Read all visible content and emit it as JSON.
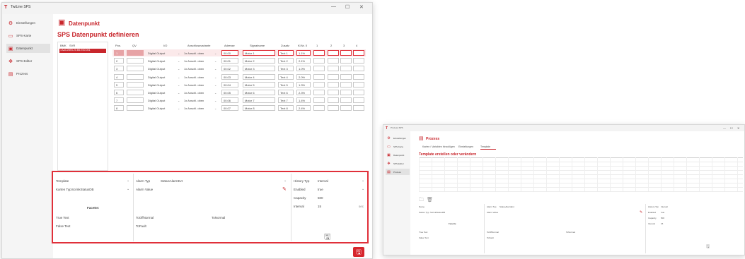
{
  "app": {
    "title": "TwiLine SPS"
  },
  "window_controls": [
    "—",
    "☐",
    "✕"
  ],
  "sidebar": {
    "items": [
      {
        "label": "Einstellungen",
        "icon": "settings-icon"
      },
      {
        "label": "SPS-Karte",
        "icon": "card-icon"
      },
      {
        "label": "Datenpunkt",
        "icon": "datapoint-icon"
      },
      {
        "label": "SPS-Editor",
        "icon": "editor-icon"
      },
      {
        "label": "Prozess",
        "icon": "process-icon"
      }
    ]
  },
  "main": {
    "header": "Datenpunkt",
    "subtitle": "SPS Datenpunkt definieren",
    "bmk_columns": [
      "BMK",
      "SVR"
    ],
    "bmk_selected": "=AAC25E5.20.B5.E00.001",
    "columns": [
      "Pos.",
      "QV",
      "I/O",
      "Anschlussvariante",
      "Adresse",
      "Signalname",
      "Zusatz",
      "Kl.Nr. 0",
      "1",
      "2",
      "3",
      "4"
    ],
    "rows": [
      {
        "pos": "1",
        "io": "Digital Output",
        "variant": "1x Anschl. oben",
        "address": "00.00",
        "signal": "Motor 1",
        "extra": "Text 1",
        "kl": "1.1%"
      },
      {
        "pos": "2",
        "io": "Digital Output",
        "variant": "1x Anschl. oben",
        "address": "00.01",
        "signal": "Motor 2",
        "extra": "Text 2",
        "kl": "2.1%"
      },
      {
        "pos": "3",
        "io": "Digital Output",
        "variant": "1x Anschl. oben",
        "address": "00.02",
        "signal": "Motor 3",
        "extra": "Text 3",
        "kl": "1.0%"
      },
      {
        "pos": "4",
        "io": "Digital Output",
        "variant": "1x Anschl. oben",
        "address": "00.03",
        "signal": "Motor 4",
        "extra": "Text 4",
        "kl": "2.0%"
      },
      {
        "pos": "5",
        "io": "Digital Output",
        "variant": "1x Anschl. oben",
        "address": "00.04",
        "signal": "Motor 5",
        "extra": "Text 5",
        "kl": "1.3%"
      },
      {
        "pos": "6",
        "io": "Digital Output",
        "variant": "1x Anschl. oben",
        "address": "00.05",
        "signal": "Motor 6",
        "extra": "Text 6",
        "kl": "2.3%"
      },
      {
        "pos": "7",
        "io": "Digital Output",
        "variant": "1x Anschl. oben",
        "address": "00.06",
        "signal": "Motor 7",
        "extra": "Text 7",
        "kl": "1.4%"
      },
      {
        "pos": "8",
        "io": "Digital Output",
        "variant": "1x Anschl. oben",
        "address": "00.07",
        "signal": "Motor 8",
        "extra": "Text 8",
        "kl": "2.4%"
      }
    ],
    "bottom": {
      "template_label": "Template",
      "karten_typ_label": "Karten Typ",
      "karten_typ_value": "ScrinkStatusDB",
      "facets_label": "Facette:",
      "true_text_label": "True Text",
      "false_text_label": "False Text",
      "alarm_typ_label": "Alarm Typ",
      "alarm_typ_value": "StatusAlarmEvt",
      "alarm_value_label": "Alarm Value",
      "to_normal_label": "ToOffNormal",
      "to_normal2_label": "ToNormal",
      "to_fault_label": "ToFault",
      "history_typ_label": "History Typ",
      "history_typ_value": "Interval",
      "enabled_label": "Enabled",
      "enabled_value": "true",
      "capacity_label": "Capacity",
      "capacity_value": "500",
      "interval_label": "Interval",
      "interval_value": "15",
      "interval_unit": "sec"
    }
  },
  "window2": {
    "app_title": "Prozess SPS",
    "header": "Prozess",
    "tabs": [
      "Karten / Variablen hinzufügen",
      "Einstellungen",
      "Template"
    ],
    "subtitle": "Template erstellen oder verändern",
    "sidebar_items": [
      "Einstellungen",
      "SPS-Karte",
      "Datenpunkt",
      "SPS-Editor",
      "Prozess"
    ],
    "bottom": {
      "name_label": "Name",
      "karten_typ_label": "Karten Typ",
      "karten_typ_value": "ScrinkStatusDB",
      "facets_label": "Facette",
      "true_text_label": "True Text",
      "false_text_label": "False Text",
      "alarm_typ_label": "Alarm Typ",
      "alarm_typ_value": "StatusAlarmEvt",
      "alarm_value_label": "Alarm Value",
      "to_offnormal_label": "ToOffNormal",
      "to_normal_label": "ToNormal",
      "to_fault_label": "ToFault",
      "history_typ_label": "History Typ",
      "history_typ_value": "Interval",
      "enabled_label": "Enabled",
      "enabled_value": "true",
      "capacity_label": "Capacity",
      "capacity_value": "500",
      "interval_label": "Interval",
      "interval_value": "15"
    }
  },
  "colors": {
    "accent": "#c8262c",
    "highlight": "#e0303a",
    "selection": "#c8262c"
  }
}
